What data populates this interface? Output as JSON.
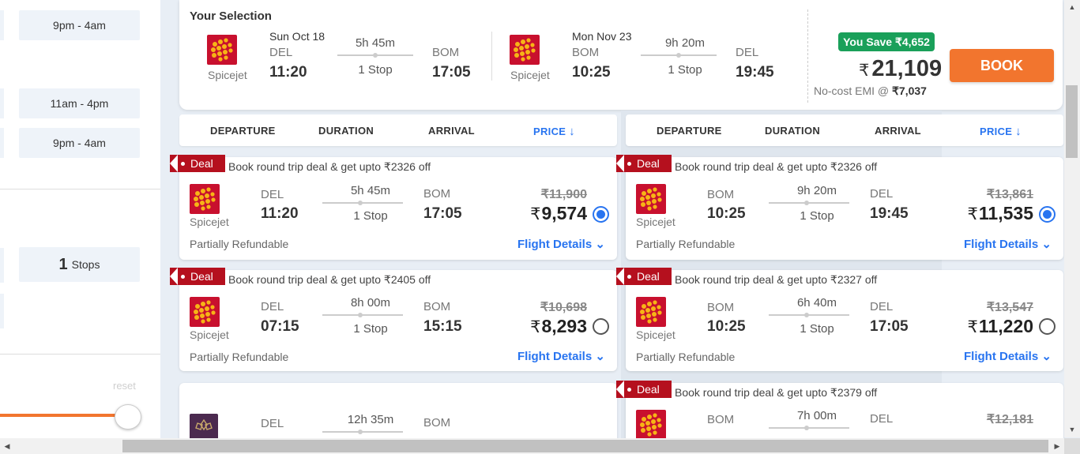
{
  "sidebar": {
    "time_chips": [
      "9pm - 4am",
      "11am - 4pm",
      "9pm - 4am"
    ],
    "stops_chip": {
      "count": "1",
      "label": "Stops"
    },
    "reset": "reset"
  },
  "selection": {
    "title": "Your Selection",
    "outbound": {
      "airline": "Spicejet",
      "date": "Sun Oct 18",
      "from_city": "DEL",
      "dep_time": "11:20",
      "duration": "5h 45m",
      "stops": "1 Stop",
      "to_city": "BOM",
      "arr_time": "17:05"
    },
    "return": {
      "airline": "Spicejet",
      "date": "Mon Nov 23",
      "from_city": "BOM",
      "dep_time": "10:25",
      "duration": "9h 20m",
      "stops": "1 Stop",
      "to_city": "DEL",
      "arr_time": "19:45"
    },
    "you_save": "You Save ₹4,652",
    "currency": "₹",
    "total": "21,109",
    "emi_label": "No-cost EMI @",
    "emi_value": "₹7,037",
    "book_label": "BOOK"
  },
  "sort_headers": {
    "departure": "DEPARTURE",
    "duration": "DURATION",
    "arrival": "ARRIVAL",
    "price": "PRICE"
  },
  "deal_label": "Deal",
  "flight_details_label": "Flight Details",
  "departures": [
    {
      "deal": "Book round trip deal & get upto ₹2326 off",
      "airline": "Spicejet",
      "from": "DEL",
      "dep": "11:20",
      "duration": "5h 45m",
      "stops": "1 Stop",
      "to": "BOM",
      "arr": "17:05",
      "old_price": "₹11,900",
      "price": "9,574",
      "refund": "Partially Refundable"
    },
    {
      "deal": "Book round trip deal & get upto ₹2405 off",
      "airline": "Spicejet",
      "from": "DEL",
      "dep": "07:15",
      "duration": "8h 00m",
      "stops": "1 Stop",
      "to": "BOM",
      "arr": "15:15",
      "old_price": "₹10,698",
      "price": "8,293",
      "refund": "Partially Refundable"
    },
    {
      "airline": "Vistara",
      "from": "DEL",
      "duration": "12h 35m",
      "to": "BOM"
    }
  ],
  "returns": [
    {
      "deal": "Book round trip deal & get upto ₹2326 off",
      "airline": "Spicejet",
      "from": "BOM",
      "dep": "10:25",
      "duration": "9h 20m",
      "stops": "1 Stop",
      "to": "DEL",
      "arr": "19:45",
      "old_price": "₹13,861",
      "price": "11,535",
      "refund": "Partially Refundable"
    },
    {
      "deal": "Book round trip deal & get upto ₹2327 off",
      "airline": "Spicejet",
      "from": "BOM",
      "dep": "10:25",
      "duration": "6h 40m",
      "stops": "1 Stop",
      "to": "DEL",
      "arr": "17:05",
      "old_price": "₹13,547",
      "price": "11,220",
      "refund": "Partially Refundable"
    },
    {
      "deal": "Book round trip deal & get upto ₹2379 off",
      "airline": "Spicejet",
      "from": "BOM",
      "duration": "7h 00m",
      "to": "DEL",
      "old_price": "₹12,181"
    }
  ],
  "colors": {
    "accent": "#2874f0",
    "book": "#f2752e",
    "deal": "#b5101e",
    "save": "#1aa05a",
    "spicejet": "#c8102e"
  }
}
